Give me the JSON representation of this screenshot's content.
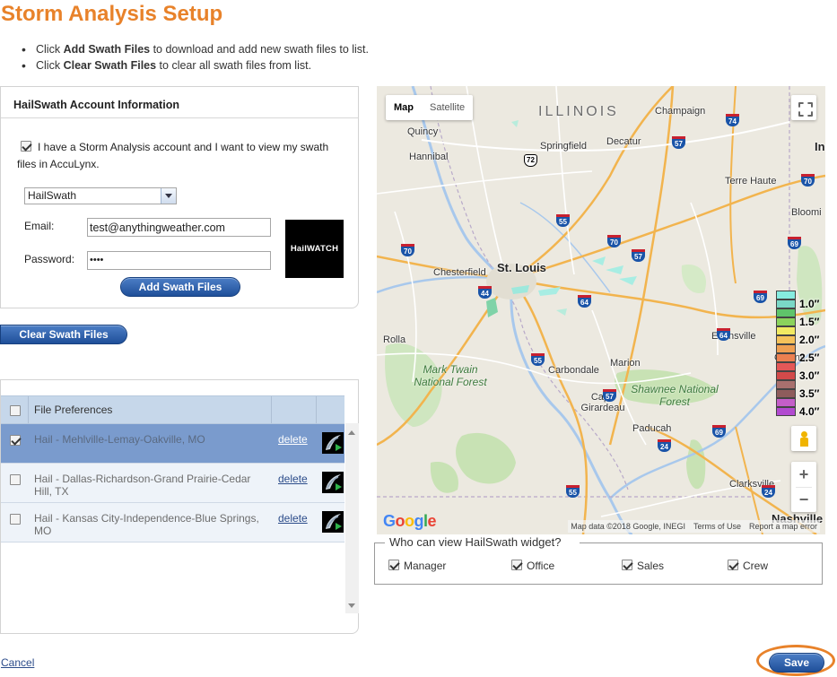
{
  "page": {
    "title": "Storm Analysis Setup",
    "instructions": [
      {
        "pre": "Click ",
        "bold": "Add Swath Files",
        "post": " to download and add new swath files to list."
      },
      {
        "pre": "Click ",
        "bold": "Clear Swath Files",
        "post": " to clear all swath files from list."
      }
    ]
  },
  "account": {
    "heading": "HailSwath Account Information",
    "has_account_checked": true,
    "has_account_label": "I have a Storm Analysis account and I want to view my swath files in AccuLynx.",
    "provider_selected": "HailSwath",
    "email_label": "Email:",
    "email_value": "test@anythingweather.com",
    "password_label": "Password:",
    "password_value": "••••",
    "logo_text": "HailWATCH",
    "add_button": "Add Swath Files"
  },
  "clear_button": "Clear Swath Files",
  "files": {
    "header": "File Preferences",
    "rows": [
      {
        "name": "Hail - Mehlville-Lemay-Oakville, MO",
        "delete": "delete",
        "checked": true,
        "selected": true
      },
      {
        "name": "Hail - Dallas-Richardson-Grand Prairie-Cedar Hill, TX",
        "delete": "delete",
        "checked": false,
        "selected": false
      },
      {
        "name": "Hail - Kansas City-Independence-Blue Springs, MO",
        "delete": "delete",
        "checked": false,
        "selected": false
      }
    ]
  },
  "map": {
    "type_buttons": [
      "Map",
      "Satellite"
    ],
    "active_type": "Map",
    "states": [
      "ILLINOIS"
    ],
    "cities": [
      "Champaign",
      "Quincy",
      "Springfield",
      "Decatur",
      "Hannibal",
      "Terre Haute",
      "Bloomi",
      "Chesterfield",
      "St. Louis",
      "Evansville",
      "Owens",
      "Rolla",
      "Carbondale",
      "Marion",
      "Cape Girardeau",
      "Paducah",
      "Clarksville",
      "Nashville",
      "In"
    ],
    "forests": [
      "Mark Twain National Forest",
      "Shawnee National Forest"
    ],
    "highway_shields": [
      "74",
      "57",
      "72",
      "55",
      "70",
      "70",
      "57",
      "69",
      "70",
      "44",
      "64",
      "64",
      "69",
      "55",
      "57",
      "24",
      "69",
      "55",
      "24"
    ],
    "legend": [
      {
        "label": "1.0″",
        "color": "#7fe0d6"
      },
      {
        "label": "1.5″",
        "color": "#6cd16a"
      },
      {
        "label": "2.0″",
        "color": "#f2e35c"
      },
      {
        "label": "2.5″",
        "color": "#f0a052"
      },
      {
        "label": "3.0″",
        "color": "#e25c5c"
      },
      {
        "label": "3.5″",
        "color": "#9b6e6e"
      },
      {
        "label": "4.0″",
        "color": "#c856d6"
      }
    ],
    "legend_swatches": [
      "#86ece0",
      "#7ad8c7",
      "#5fc46a",
      "#8bd35c",
      "#f2ea62",
      "#f6c25a",
      "#f0a052",
      "#ec8050",
      "#e45858",
      "#d24a4a",
      "#a8706e",
      "#8e5c5c",
      "#c45ec8",
      "#b24ad0"
    ],
    "google_logo": "Google",
    "attribution": [
      "Map data ©2018 Google, INEGI",
      "Terms of Use",
      "Report a map error"
    ],
    "zoom_in": "+",
    "zoom_out": "−"
  },
  "viewers": {
    "title": "Who can view HailSwath widget?",
    "options": [
      {
        "label": "Manager",
        "checked": true
      },
      {
        "label": "Office",
        "checked": true
      },
      {
        "label": "Sales",
        "checked": true
      },
      {
        "label": "Crew",
        "checked": true
      }
    ]
  },
  "footer": {
    "cancel": "Cancel",
    "save": "Save"
  },
  "colors": {
    "title_orange": "#e8822a",
    "button_blue": "#1f4f99",
    "selected_row": "#7a9bcd",
    "grid_header": "#c6d7ea"
  }
}
